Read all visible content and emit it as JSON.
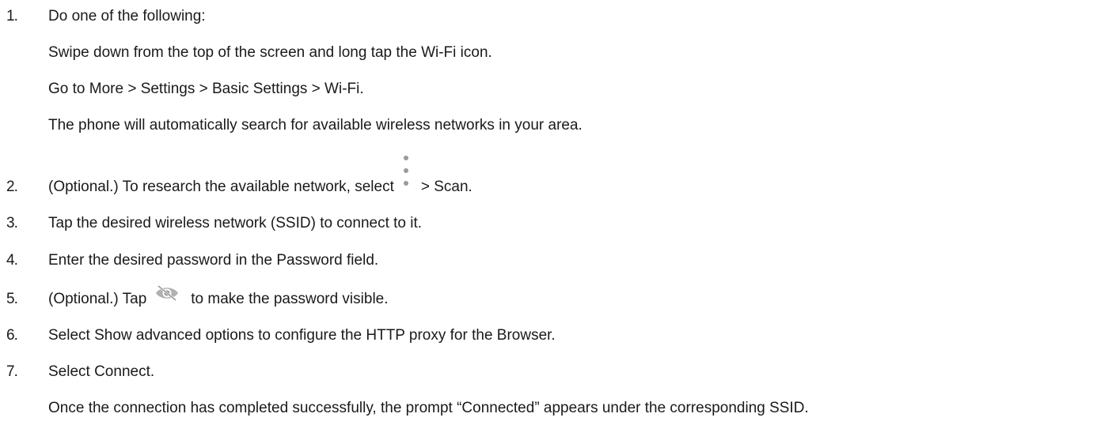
{
  "steps": [
    {
      "num": "1.",
      "text": "Do one of the following:",
      "sub": [
        "Swipe down from the top of the screen and long tap the Wi-Fi icon.",
        "Go to More > Settings > Basic Settings > Wi-Fi.",
        "The phone will automatically search for available wireless networks in your area."
      ]
    },
    {
      "num": "2.",
      "text_before": "(Optional.) To research the available network, select",
      "icon": "more-vertical-icon",
      "text_after": "> Scan."
    },
    {
      "num": "3.",
      "text": "Tap the desired wireless network (SSID) to connect to it."
    },
    {
      "num": "4.",
      "text": "Enter the desired password in the Password field."
    },
    {
      "num": "5.",
      "text_before": "(Optional.) Tap",
      "icon": "eye-visibility-icon",
      "text_after": "to make the password visible."
    },
    {
      "num": "6.",
      "text": "Select Show advanced options to configure the HTTP proxy for the Browser."
    },
    {
      "num": "7.",
      "text": "Select Connect.",
      "sub": [
        "Once the connection has completed successfully, the prompt “Connected” appears under the corresponding SSID."
      ]
    }
  ],
  "colors": {
    "text": "#1a1a1a",
    "icon": "#9a9a9a"
  }
}
